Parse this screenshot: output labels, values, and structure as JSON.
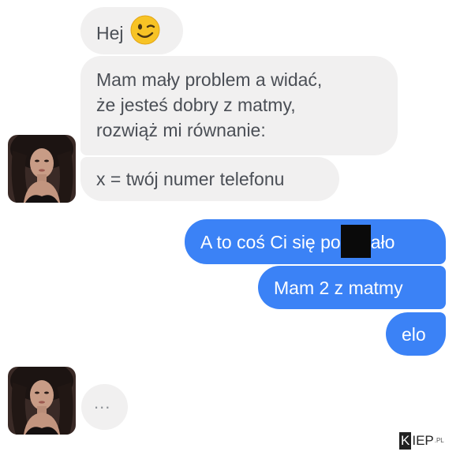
{
  "conversation": {
    "incoming_1": {
      "text": "Hej",
      "emoji": "winking-smiley"
    },
    "incoming_2": {
      "lines": [
        "Mam mały problem a widać,",
        "że jesteś dobry z matmy,",
        "rozwiąż mi równanie:"
      ]
    },
    "incoming_3": {
      "text": "x = twój numer telefonu"
    },
    "outgoing_1": {
      "text_before": "A to coś Ci się po",
      "text_after": "ało"
    },
    "outgoing_2": {
      "text": "Mam 2 z matmy"
    },
    "outgoing_3": {
      "text": "elo"
    },
    "typing": {
      "text": "..."
    }
  },
  "colors": {
    "incoming_bubble": "#f1f0f0",
    "outgoing_bubble": "#3b82f6",
    "censor_box": "#0a0a0a"
  },
  "watermark": {
    "logo": "KIEP.PL"
  }
}
